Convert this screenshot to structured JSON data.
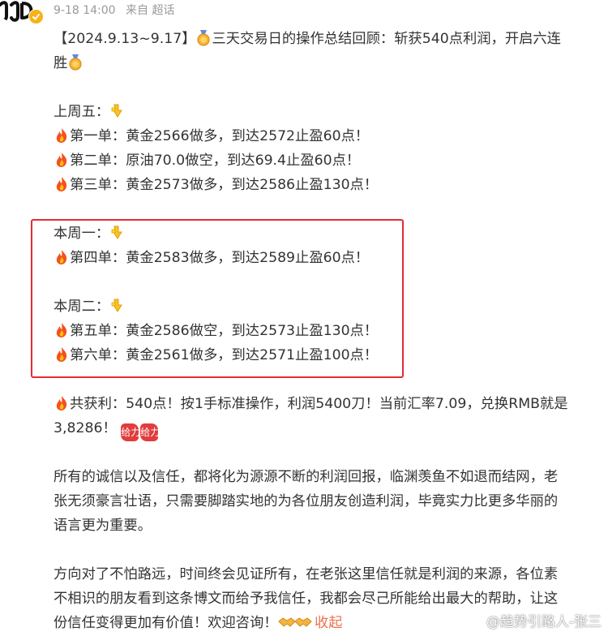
{
  "header": {
    "timestamp": "9-18 14:00",
    "source": "来自 超话",
    "avatar_text": "JJD"
  },
  "post": {
    "title_line1": "【2024.9.13~9.17】",
    "title_line1b": "三天交易日的操作总结回顾：斩获540点利润，开启六连",
    "title_line2": "胜",
    "fri_label": "上周五：",
    "trade1": "第一单：黄金2566做多，到达2572止盈60点！",
    "trade2": "第二单：原油70.0做空，到达69.4止盈60点！",
    "trade3": "第三单：黄金2573做多，到达2586止盈130点！",
    "mon_label": "本周一：",
    "trade4": "第四单：黄金2583做多，到达2589止盈60点！",
    "tue_label": "本周二：",
    "trade5": "第五单：黄金2586做空，到达2573止盈130点！",
    "trade6": "第六单：黄金2561做多，到达2571止盈100点！",
    "total_line1": "共获利：540点！按1手标准操作，利润5400刀！当前汇率7.09，兑换RMB就是",
    "total_line2": "3,8286！",
    "jia_text": "给力",
    "para1_line1": "所有的诚信以及信任，都将化为源源不断的利润回报，临渊羡鱼不如退而结网，老",
    "para1_line2": "张无须豪言壮语，只需要脚踏实地的为各位朋友创造利润，毕竟实力比更多华丽的",
    "para1_line3": "语言更为重要。",
    "para2_line1": "方向对了不怕路远，时间终会见证所有，在老张这里信任就是利润的来源，各位素",
    "para2_line2": "不相识的朋友看到这条博文而给予我信任，我都会尽己所能给出最大的帮助，让这",
    "para2_line3": "份信任变得更加有价值！欢迎咨询！",
    "collapse_label": "收起"
  },
  "watermark": {
    "text": "@趋势引路人-张三"
  },
  "colors": {
    "highlight_border": "#e22c36",
    "meta_text": "#999999",
    "body_text": "#333333",
    "link": "#eb7350",
    "verified_badge": "#f8b215"
  },
  "icons": [
    "fire-icon",
    "point-down-icon",
    "medal-icon",
    "handshake-icon",
    "verified-icon",
    "weibo-logo-icon"
  ]
}
